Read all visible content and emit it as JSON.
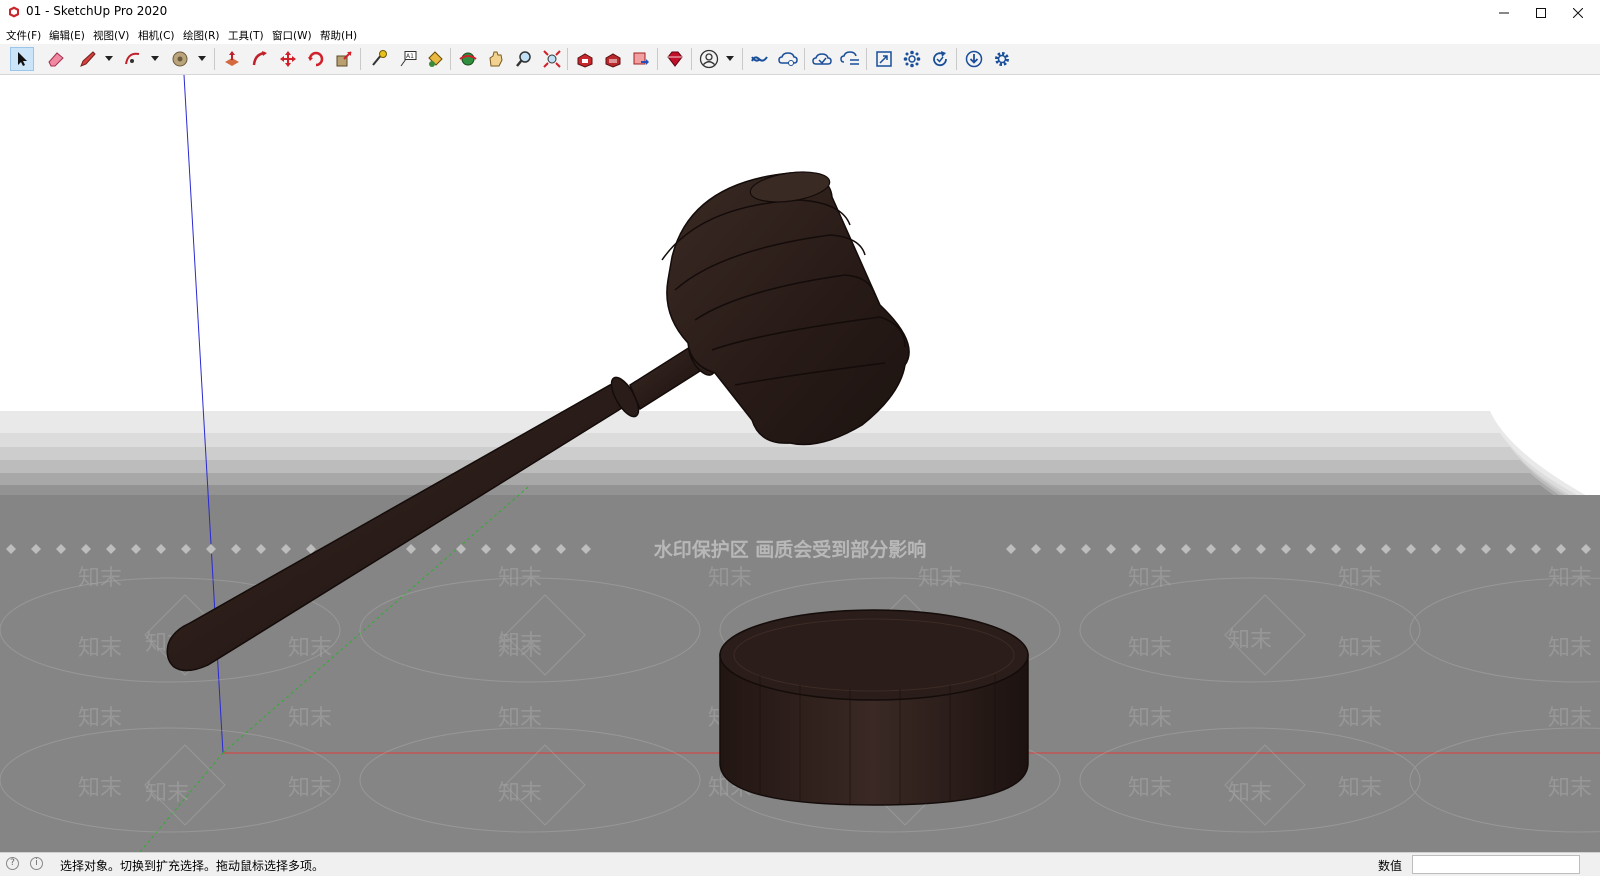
{
  "window": {
    "title": "01 - SketchUp Pro 2020",
    "controls": [
      "minimize",
      "maximize",
      "close"
    ]
  },
  "menu": [
    {
      "label": "文件(F)"
    },
    {
      "label": "编辑(E)"
    },
    {
      "label": "视图(V)"
    },
    {
      "label": "相机(C)"
    },
    {
      "label": "绘图(R)"
    },
    {
      "label": "工具(T)"
    },
    {
      "label": "窗口(W)"
    },
    {
      "label": "帮助(H)"
    }
  ],
  "toolbar": {
    "tools": [
      "select-icon",
      "eraser-icon",
      "pencil-line-icon",
      "arc-icon",
      "paint-bucket-icon",
      "push-pull-icon",
      "offset-icon",
      "move-icon",
      "rotate-icon",
      "scale-icon",
      "tape-measure-icon",
      "text-icon",
      "paint-icon",
      "orbit-icon",
      "pan-icon",
      "zoom-icon",
      "zoom-extents-icon",
      "3d-warehouse-icon",
      "extension-warehouse-icon",
      "send-to-layout-icon",
      "ruby-console-icon",
      "account-icon",
      "trimble-connect-icon",
      "trimble-share-icon",
      "cloud-download-icon",
      "cloud-sync-icon",
      "scale-model-icon",
      "components-icon",
      "reload-icon",
      "extension-download-icon",
      "settings-icon"
    ],
    "active_tool": "select-icon"
  },
  "viewport": {
    "watermark_banner": "水印保护区   画质会受到部分影响",
    "watermark_text": "知末",
    "axis_colors": {
      "red": "#e03a3a",
      "green": "#2fae2f",
      "blue": "#2a2ad0"
    },
    "model_color": "#2c1e1a"
  },
  "statusbar": {
    "message": "选择对象。切换到扩充选择。拖动鼠标选择多项。",
    "measurement_label": "数值",
    "measurement_value": ""
  }
}
